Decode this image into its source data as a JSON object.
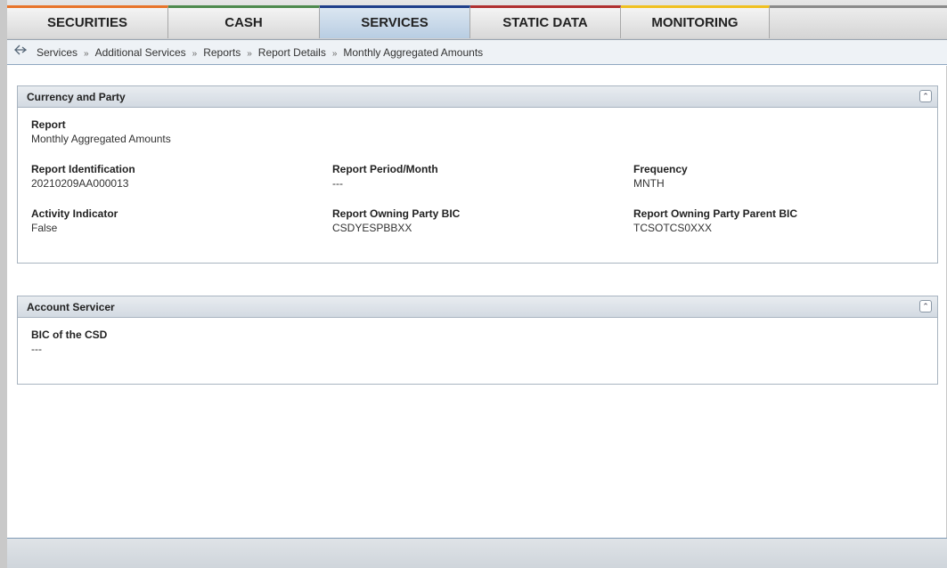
{
  "nav": {
    "tabs": [
      {
        "label": "SECURITIES",
        "color": "#e8742a",
        "active": false
      },
      {
        "label": "CASH",
        "color": "#4e8a4e",
        "active": false
      },
      {
        "label": "SERVICES",
        "color": "#1f3f8a",
        "active": true
      },
      {
        "label": "STATIC DATA",
        "color": "#b03030",
        "active": false
      },
      {
        "label": "MONITORING",
        "color": "#f0c020",
        "active": false
      }
    ]
  },
  "breadcrumb": {
    "items": [
      "Services",
      "Additional Services",
      "Reports",
      "Report Details",
      "Monthly Aggregated Amounts"
    ],
    "separator": "»"
  },
  "panels": {
    "currency_party": {
      "title": "Currency and Party",
      "report_label": "Report",
      "report_value": "Monthly Aggregated Amounts",
      "report_id_label": "Report Identification",
      "report_id_value": "20210209AA000013",
      "period_label": "Report Period/Month",
      "period_value": "---",
      "frequency_label": "Frequency",
      "frequency_value": "MNTH",
      "activity_label": "Activity Indicator",
      "activity_value": "False",
      "owning_bic_label": "Report Owning Party BIC",
      "owning_bic_value": "CSDYESPBBXX",
      "parent_bic_label": "Report Owning Party Parent BIC",
      "parent_bic_value": "TCSOTCS0XXX"
    },
    "account_servicer": {
      "title": "Account Servicer",
      "csd_bic_label": "BIC of the CSD",
      "csd_bic_value": "---"
    }
  },
  "icons": {
    "back": "back-arrow-icon",
    "collapse": "double-chevron-up-icon"
  }
}
